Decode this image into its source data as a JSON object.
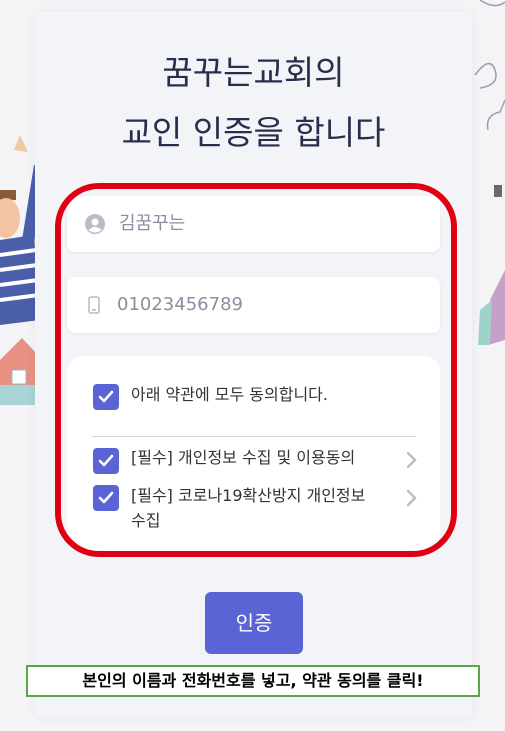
{
  "title": {
    "line1": "꿈꾸는교회의",
    "line2": "교인 인증을 합니다"
  },
  "form": {
    "name_value": "김꿈꾸는",
    "phone_value": "01023456789"
  },
  "agreements": {
    "all_label": "아래 약관에 모두 동의합니다.",
    "items": [
      {
        "label": "[필수] 개인정보 수집 및 이용동의",
        "checked": true
      },
      {
        "label_line1": "[필수] 코로나19확산방지 개인정보",
        "label_line2": "수집",
        "checked": true
      }
    ],
    "all_checked": true
  },
  "submit_label": "인증",
  "caption": "본인의 이름과 전화번호를 넣고, 약관 동의를 클릭!",
  "colors": {
    "accent": "#5b64d4",
    "highlight": "#e00012",
    "caption_border": "#5aa548"
  }
}
